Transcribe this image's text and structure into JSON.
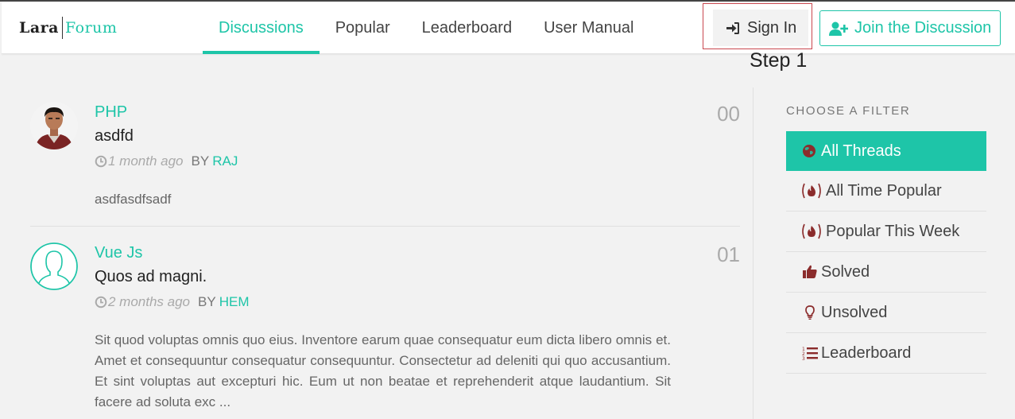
{
  "brand": {
    "left": "Lara",
    "right": "Forum"
  },
  "nav": [
    {
      "label": "Discussions",
      "active": true
    },
    {
      "label": "Popular",
      "active": false
    },
    {
      "label": "Leaderboard",
      "active": false
    },
    {
      "label": "User Manual",
      "active": false
    }
  ],
  "auth": {
    "signin_label": "Sign In",
    "join_label": "Join the Discussion"
  },
  "annotation": {
    "step": "Step 1"
  },
  "threads": [
    {
      "category": "PHP",
      "title": "asdfd",
      "time": "1 month ago",
      "by": "BY",
      "user": "RAJ",
      "count": "00",
      "body": "asdfasdfsadf"
    },
    {
      "category": "Vue Js",
      "title": "Quos ad magni.",
      "time": "2 months ago",
      "by": "BY",
      "user": "HEM",
      "count": "01",
      "body": "Sit quod voluptas omnis quo eius. Inventore earum quae consequatur eum dicta libero omnis et. Amet et consequuntur consequatur consequuntur. Consectetur ad deleniti qui quo accusantium. Et sint voluptas aut excepturi hic. Eum ut non beatae et reprehenderit atque laudantium. Sit facere ad soluta exc ..."
    }
  ],
  "sidebar": {
    "heading": "CHOOSE A FILTER",
    "filters": [
      {
        "label": "All Threads",
        "icon": "globe-icon"
      },
      {
        "label": "All Time Popular",
        "icon": "fire-icon"
      },
      {
        "label": "Popular This Week",
        "icon": "fire-icon"
      },
      {
        "label": "Solved",
        "icon": "thumbs-up-icon"
      },
      {
        "label": "Unsolved",
        "icon": "lightbulb-icon"
      },
      {
        "label": "Leaderboard",
        "icon": "list-ol-icon"
      }
    ]
  },
  "colors": {
    "accent": "#1ec5a8",
    "icon_red": "#8b2c2c",
    "highlight_border": "#c9474f"
  }
}
